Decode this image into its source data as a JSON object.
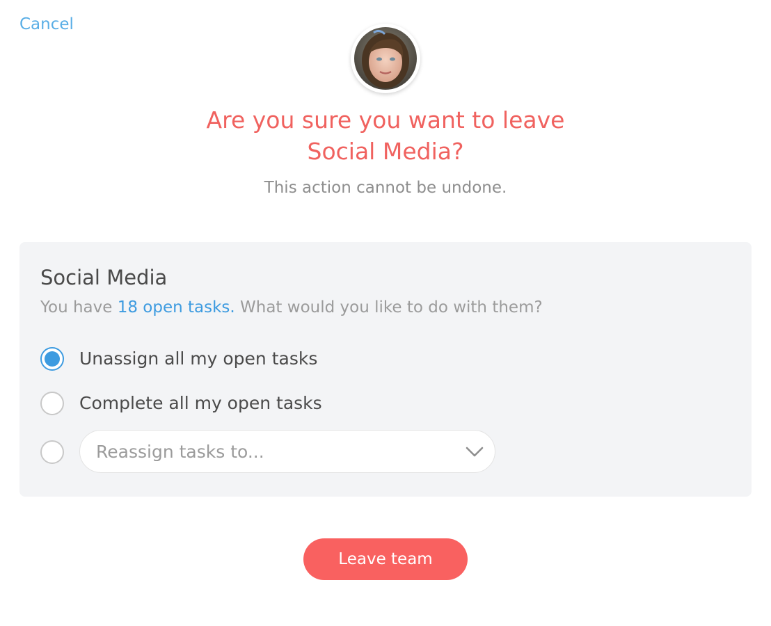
{
  "header": {
    "cancel_label": "Cancel"
  },
  "dialog": {
    "title_line1": "Are you sure you want to leave",
    "title_line2": "Social Media?",
    "subtitle": "This action cannot be undone."
  },
  "team_panel": {
    "team_name": "Social Media",
    "summary_prefix": "You have ",
    "open_tasks_link": "18 open tasks.",
    "summary_suffix": " What would you like to do with them?",
    "options": [
      {
        "label": "Unassign all my open tasks",
        "selected": true
      },
      {
        "label": "Complete all my open tasks",
        "selected": false
      },
      {
        "label": "",
        "selected": false
      }
    ],
    "reassign_select": {
      "placeholder": "Reassign tasks to..."
    }
  },
  "actions": {
    "leave_label": "Leave team"
  },
  "colors": {
    "accent_red": "#f0625f",
    "button_red": "#f96160",
    "link_blue": "#3d9be0",
    "cancel_blue": "#59aee6",
    "panel_bg": "#f3f4f6"
  },
  "icons": {
    "avatar": "user-avatar",
    "select_chevron": "chevron-down-icon"
  }
}
